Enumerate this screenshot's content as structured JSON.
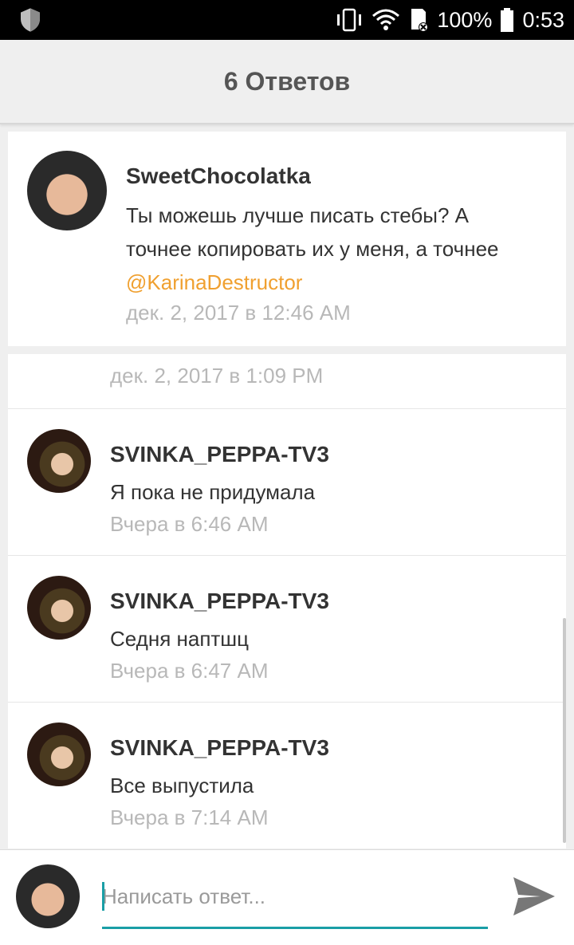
{
  "status_bar": {
    "battery": "100%",
    "time": "0:53",
    "icons": [
      "shield-icon",
      "vibrate-icon",
      "wifi-icon",
      "sd-card-icon",
      "battery-icon"
    ]
  },
  "header": {
    "title": "6 Ответов"
  },
  "original_comment": {
    "author": "SweetChocolatka",
    "text_line1": "Ты можешь лучше писать стебы? А",
    "text_line2": "точнее копировать их у меня, а точнее",
    "mention": "@KarinaDestructor",
    "timestamp": "дек. 2, 2017 в 12:46 AM"
  },
  "replies": [
    {
      "timestamp": "дек. 2, 2017 в 1:09 PM"
    },
    {
      "author": "SVINKA_PEPPA-TV3",
      "text": "Я пока не придумала",
      "timestamp": "Вчера в 6:46 AM"
    },
    {
      "author": "SVINKA_PEPPA-TV3",
      "text": "Седня наптшц",
      "timestamp": "Вчера в 6:47 AM"
    },
    {
      "author": "SVINKA_PEPPA-TV3",
      "text": "Все выпустила",
      "timestamp": "Вчера в 7:14 AM"
    }
  ],
  "reply_bar": {
    "placeholder": "Написать ответ...",
    "value": ""
  },
  "colors": {
    "accent": "#1a9ea6",
    "mention": "#f0a030",
    "timestamp": "#b8b8b8"
  }
}
